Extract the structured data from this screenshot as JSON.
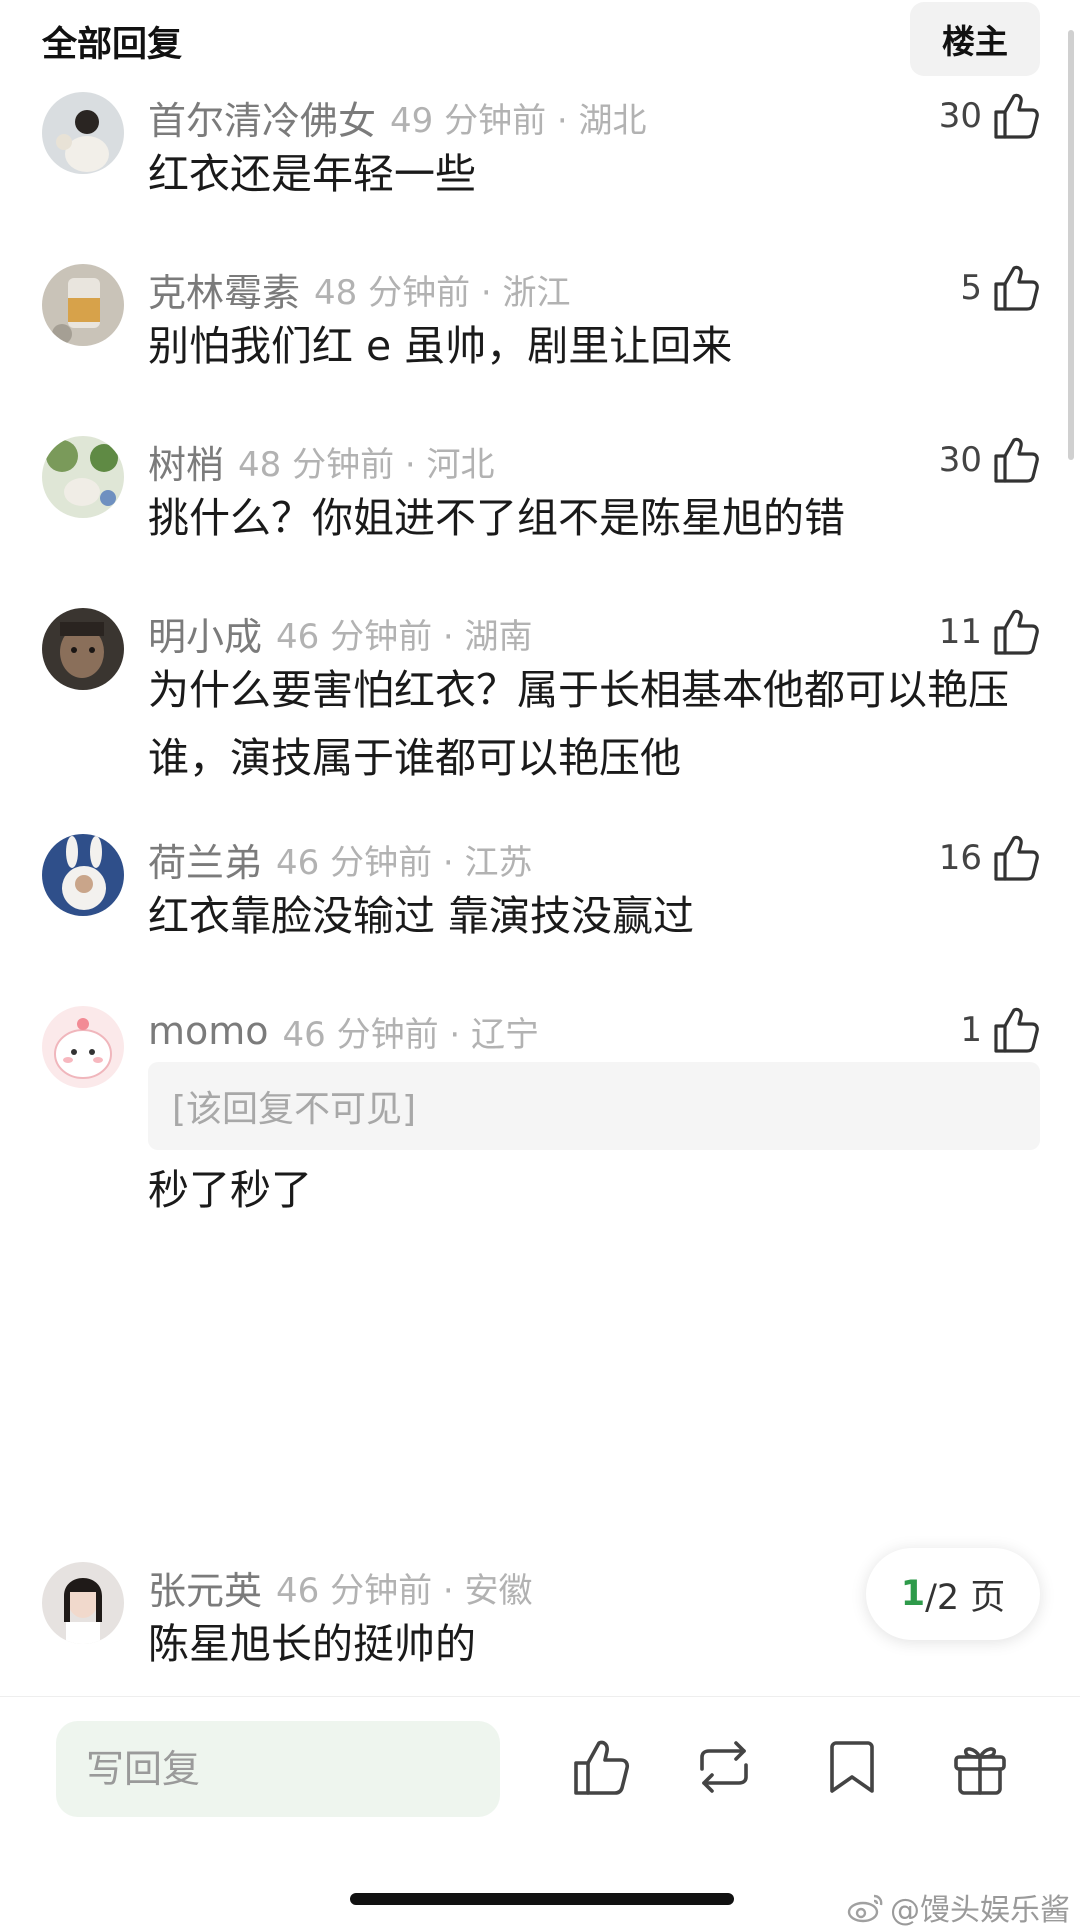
{
  "header": {
    "title": "全部回复",
    "owner_button": "楼主"
  },
  "comments": [
    {
      "username": "首尔清冷佛女",
      "time_location": "49 分钟前 · 湖北",
      "likes": "30",
      "text": "红衣还是年轻一些"
    },
    {
      "username": "克林霉素",
      "time_location": "48 分钟前 · 浙江",
      "likes": "5",
      "text": "别怕我们红 e 虽帅，剧里让回来"
    },
    {
      "username": "树梢",
      "time_location": "48 分钟前 · 河北",
      "likes": "30",
      "text": "挑什么？你姐进不了组不是陈星旭的错"
    },
    {
      "username": "明小成",
      "time_location": "46 分钟前 · 湖南",
      "likes": "11",
      "text": "为什么要害怕红衣？属于长相基本他都可以艳压谁，演技属于谁都可以艳压他"
    },
    {
      "username": "荷兰弟",
      "time_location": "46 分钟前 · 江苏",
      "likes": "16",
      "text": "红衣靠脸没输过 靠演技没赢过"
    },
    {
      "username": "momo",
      "time_location": "46 分钟前 · 辽宁",
      "likes": "1",
      "hidden_reply": "[该回复不可见]",
      "text": "秒了秒了"
    },
    {
      "username": "张元英",
      "time_location": "46 分钟前 · 安徽",
      "likes": "",
      "text": "陈星旭长的挺帅的"
    }
  ],
  "pagination": {
    "current": "1",
    "total_text": "/2 页"
  },
  "bottom_bar": {
    "reply_placeholder": "写回复",
    "icons": [
      "like-icon",
      "repost-icon",
      "bookmark-icon",
      "gift-icon"
    ]
  },
  "watermark": "@馒头娱乐酱",
  "colors": {
    "accent_green": "#2e9a4a",
    "reply_input_bg": "#eef5ee",
    "meta_gray": "#b2b2b2"
  }
}
